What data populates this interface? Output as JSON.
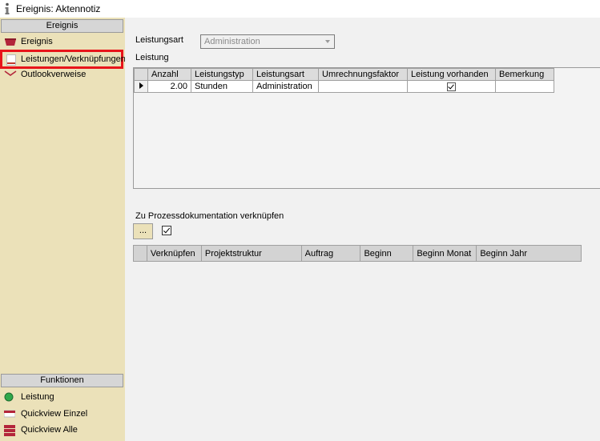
{
  "window": {
    "title": "Ereignis: Aktennotiz",
    "icon": "info-icon"
  },
  "sidebar": {
    "section_top": "Ereignis",
    "items_top": [
      {
        "label": "Ereignis",
        "icon": "event-icon",
        "color": "#c0392b"
      },
      {
        "label": "Leistungen/Verknüpfungen",
        "icon": "services-icon",
        "color": "#c0392b",
        "selected": true
      },
      {
        "label": "Outlookverweise",
        "icon": "outlook-icon",
        "color": "#c0392b"
      }
    ],
    "section_bottom": "Funktionen",
    "items_bottom": [
      {
        "label": "Leistung",
        "icon": "green-circle-icon",
        "color": "#2ea84a"
      },
      {
        "label": "Quickview Einzel",
        "icon": "quickview-single-icon",
        "color": "#c0392b"
      },
      {
        "label": "Quickview Alle",
        "icon": "quickview-all-icon",
        "color": "#c0392b"
      }
    ]
  },
  "main": {
    "leistungsart_label": "Leistungsart",
    "leistungsart_value": "Administration",
    "leistung_label": "Leistung",
    "grid1": {
      "columns": [
        "Anzahl",
        "Leistungstyp",
        "Leistungsart",
        "Umrechnungsfaktor",
        "Leistung vorhanden",
        "Bemerkung"
      ],
      "rows": [
        {
          "anzahl": "2.00",
          "leistungstyp": "Stunden",
          "leistungsart": "Administration",
          "umrechnungsfaktor": "",
          "vorhanden": true,
          "bemerkung": ""
        }
      ]
    },
    "prozess_label": "Zu Prozessdokumentation verknüpfen",
    "dots_button": "...",
    "prozess_checked": true,
    "grid2": {
      "columns": [
        "Verknüpfen",
        "Projektstruktur",
        "Auftrag",
        "Beginn",
        "Beginn Monat",
        "Beginn Jahr"
      ]
    }
  }
}
